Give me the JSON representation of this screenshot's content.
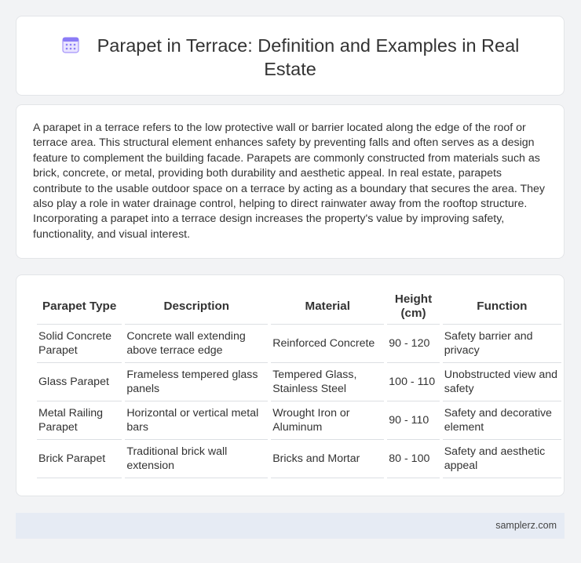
{
  "header": {
    "icon": "calendar-icon",
    "title": "Parapet in Terrace: Definition and Examples in Real Estate",
    "icon_color": "#8b7cf6"
  },
  "description": "A parapet in a terrace refers to the low protective wall or barrier located along the edge of the roof or terrace area. This structural element enhances safety by preventing falls and often serves as a design feature to complement the building facade. Parapets are commonly constructed from materials such as brick, concrete, or metal, providing both durability and aesthetic appeal. In real estate, parapets contribute to the usable outdoor space on a terrace by acting as a boundary that secures the area. They also play a role in water drainage control, helping to direct rainwater away from the rooftop structure. Incorporating a parapet into a terrace design increases the property's value by improving safety, functionality, and visual interest.",
  "table": {
    "headers": [
      "Parapet Type",
      "Description",
      "Material",
      "Height (cm)",
      "Function"
    ],
    "rows": [
      [
        "Solid Concrete Parapet",
        "Concrete wall extending above terrace edge",
        "Reinforced Concrete",
        "90 - 120",
        "Safety barrier and privacy"
      ],
      [
        "Glass Parapet",
        "Frameless tempered glass panels",
        "Tempered Glass, Stainless Steel",
        "100 - 110",
        "Unobstructed view and safety"
      ],
      [
        "Metal Railing Parapet",
        "Horizontal or vertical metal bars",
        "Wrought Iron or Aluminum",
        "90 - 110",
        "Safety and decorative element"
      ],
      [
        "Brick Parapet",
        "Traditional brick wall extension",
        "Bricks and Mortar",
        "80 - 100",
        "Safety and aesthetic appeal"
      ]
    ]
  },
  "footer": {
    "site": "samplerz.com"
  }
}
